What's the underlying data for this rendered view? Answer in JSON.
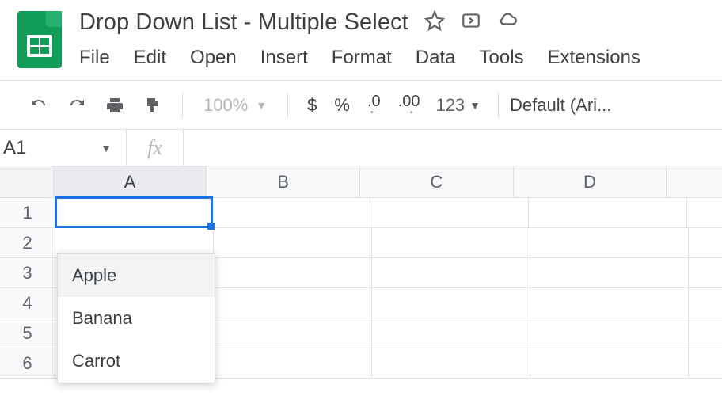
{
  "doc": {
    "title": "Drop Down List - Multiple Select"
  },
  "menubar": [
    "File",
    "Edit",
    "Open",
    "Insert",
    "Format",
    "Data",
    "Tools",
    "Extensions"
  ],
  "toolbar": {
    "zoom": "100%",
    "currency": "$",
    "percent": "%",
    "dec_decrease": ".0",
    "dec_increase": ".00",
    "numfmt": "123",
    "font": "Default (Ari..."
  },
  "fxbar": {
    "namebox": "A1",
    "fx_label": "fx"
  },
  "grid": {
    "columns": [
      "A",
      "B",
      "C",
      "D"
    ],
    "rows": [
      "1",
      "2",
      "3",
      "4",
      "5",
      "6"
    ],
    "active_column_index": 0,
    "selected_cell": "A1"
  },
  "dropdown": {
    "items": [
      "Apple",
      "Banana",
      "Carrot"
    ],
    "hovered_index": 0
  }
}
